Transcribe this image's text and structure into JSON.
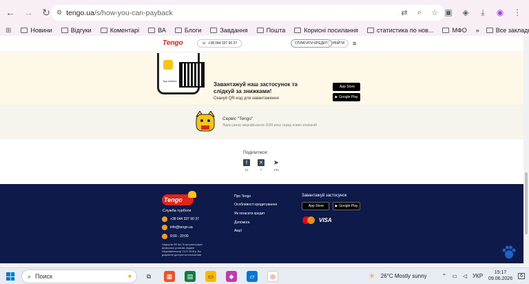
{
  "browser": {
    "url_host": "tengo.ua",
    "url_path": "/s/how-you-can-payback",
    "bookmarks": [
      "Новини",
      "Відгуки",
      "Коментарі",
      "ВА",
      "Блоги",
      "Завдання",
      "Пошта",
      "Корисні посилання",
      "статистика по нов...",
      "МФО"
    ],
    "all_bookmarks": "Все закладки",
    "more_bookmarks": "»"
  },
  "header": {
    "logo": "Tengo",
    "phone": "+38 044 337 00 37",
    "pay_button": "СПЛАТИТИ КРЕДИТ",
    "login_button": "УВІЙТИ"
  },
  "app_promo": {
    "title": "Завантажуй наш застосунок та слідкуй за знижками!",
    "subtitle": "Скануй QR-код для завантаження",
    "app_store": "App Store",
    "google_play": "Google Play",
    "app_store_small": "Download on the",
    "google_play_small": "GET IT ON",
    "phone_label": "Що нового"
  },
  "service": {
    "title": "Сервіс \"Tengo\"",
    "subtitle": "Лідер ринку мікрофінансів 2020 року серед нових компаній"
  },
  "share": {
    "label": "Поділитися:",
    "items": [
      {
        "icon": "facebook-icon",
        "glyph": "f",
        "count": "21"
      },
      {
        "icon": "x-icon",
        "glyph": "✕",
        "count": "7"
      },
      {
        "icon": "telegram-icon",
        "glyph": "➤",
        "count": "103"
      }
    ]
  },
  "footer": {
    "logo": "Tengo",
    "support": "Служба турботи",
    "contacts": [
      "+38 044 337 00 37",
      "info@tengo.ua",
      "9:00 - 20:00"
    ],
    "legal": "Свідоцтво ФК №176 про реєстрацію фінансової установи, видане Нацкомфінпослуг 19.07.2018 р. Всі документи доступні за посиланням",
    "nav": [
      "Про Tengo",
      "Особливості кредитування",
      "Як погасити кредит",
      "Допомога",
      "Акції"
    ],
    "download_label": "Завантажуй застосунок",
    "visa": "VISA"
  },
  "taskbar": {
    "search": "Поиск",
    "weather": "26°C  Mostly sunny",
    "lang": "УКР",
    "time": "15:17",
    "date": "09.06.2026",
    "notifications": "6"
  },
  "colors": {
    "brand_red": "#e2231a",
    "brand_yellow": "#f5c518",
    "footer_bg": "#0e1a4a",
    "promo_bg": "#fdf8e7"
  }
}
